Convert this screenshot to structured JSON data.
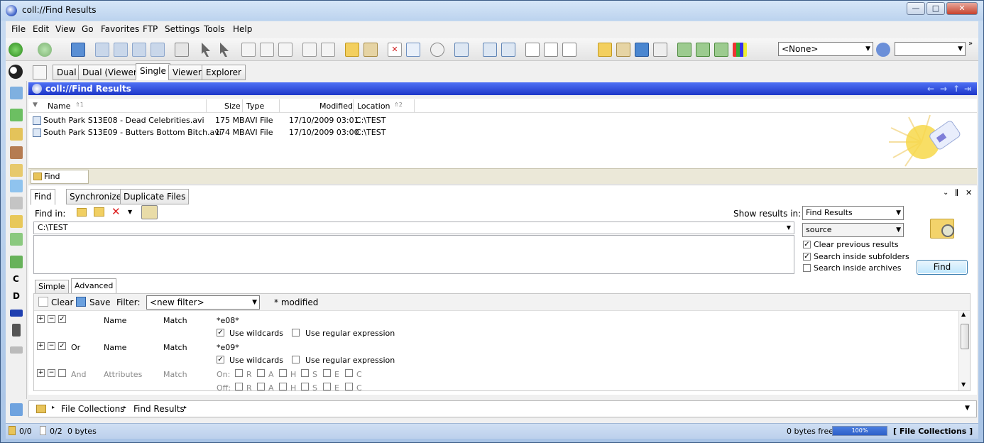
{
  "window": {
    "title": "coll://Find Results",
    "min": "—",
    "max": "□",
    "close": "✕"
  },
  "menu": [
    "File",
    "Edit",
    "View",
    "Go",
    "Favorites",
    "FTP",
    "Settings",
    "Tools",
    "Help"
  ],
  "toolbar": {
    "layout_select": "<None>"
  },
  "view_tabs": [
    "Dual",
    "Dual (Viewer)",
    "Single",
    "Viewer",
    "Explorer"
  ],
  "pathbar": {
    "path": "coll://Find Results"
  },
  "columns": {
    "name": "Name",
    "name_sort": "⇑1",
    "size": "Size",
    "type": "Type",
    "modified": "Modified",
    "location": "Location",
    "location_sort": "⇑2"
  },
  "files": [
    {
      "name": "South Park S13E08 - Dead Celebrities.avi",
      "size": "175 MB",
      "type": "AVI File",
      "modified": "17/10/2009 03:01",
      "location": "C:\\TEST"
    },
    {
      "name": "South Park S13E09 - Butters Bottom Bitch.avi",
      "size": "174 MB",
      "type": "AVI File",
      "modified": "17/10/2009 03:00",
      "location": "C:\\TEST"
    }
  ],
  "panel_tab": "Find Results",
  "find_tabs": [
    "Find",
    "Synchronize",
    "Duplicate Files"
  ],
  "find": {
    "find_in_label": "Find in:",
    "find_in_value": "C:\\TEST",
    "show_results_label": "Show results in:",
    "show_results_value": "Find Results",
    "source_value": "source",
    "clear_previous": "Clear previous results",
    "search_subfolders": "Search inside subfolders",
    "search_archives": "Search inside archives",
    "find_button": "Find"
  },
  "mode_tabs": [
    "Simple",
    "Advanced"
  ],
  "filter": {
    "clear": "Clear",
    "save": "Save",
    "filter_label": "Filter:",
    "filter_value": "<new filter>",
    "modified_note": "* modified",
    "rows": [
      {
        "op": "",
        "field": "Name",
        "match": "Match",
        "value": "*e08*",
        "wildcards": "Use wildcards",
        "regex": "Use regular expression"
      },
      {
        "op": "Or",
        "field": "Name",
        "match": "Match",
        "value": "*e09*",
        "wildcards": "Use wildcards",
        "regex": "Use regular expression"
      },
      {
        "op": "And",
        "field": "Attributes",
        "match": "Match",
        "on": "On:",
        "off": "Off:",
        "attrs": [
          "R",
          "A",
          "H",
          "S",
          "E",
          "C"
        ]
      }
    ]
  },
  "breadcrumb": [
    "File Collections",
    "Find Results"
  ],
  "status": {
    "sel1": "0/0",
    "sel2": "0/2",
    "bytes": "0 bytes",
    "free": "0 bytes free",
    "progress": "100%",
    "collection": "[ File Collections ]"
  }
}
